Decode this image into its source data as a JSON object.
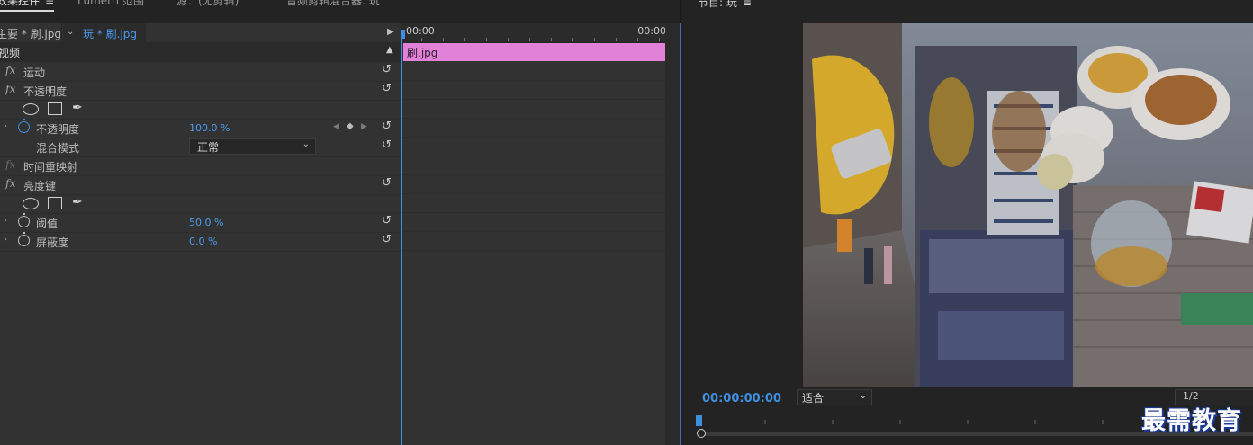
{
  "tabs": [
    {
      "label": "效果控件",
      "active": true
    },
    {
      "label": "Lumetri 范围",
      "active": false
    },
    {
      "label": "源：(无剪辑)",
      "active": false
    },
    {
      "label": "音频剪辑混合器: 玩",
      "active": false
    }
  ],
  "effect_controls": {
    "source_clip": "主要 * 刷.jpg",
    "sequence_clip": "玩 * 刷.jpg",
    "section_video": "视频",
    "rows": {
      "motion": "运动",
      "opacity": "不透明度",
      "opacity_prop": "不透明度",
      "opacity_value": "100.0 %",
      "blend_mode_label": "混合模式",
      "blend_mode_value": "正常",
      "time_remap": "时间重映射",
      "luma_key": "亮度键",
      "threshold": "阈值",
      "threshold_value": "50.0 %",
      "cutoff": "屏蔽度",
      "cutoff_value": "0.0 %"
    },
    "fx_glyph": "fx",
    "reset_glyph": "↺"
  },
  "timeline": {
    "start_time": "00:00",
    "end_time": "00:00",
    "clip_label": "刷.jpg",
    "clip_color": "#e182d8"
  },
  "program_monitor": {
    "title": "节目: 玩",
    "timecode": "00:00:00:00",
    "fit_label": "适合",
    "resolution": "1/2"
  },
  "watermark": "最需教育",
  "colors": {
    "accent": "#3f8fe0",
    "panel": "#323232",
    "background": "#232323"
  }
}
